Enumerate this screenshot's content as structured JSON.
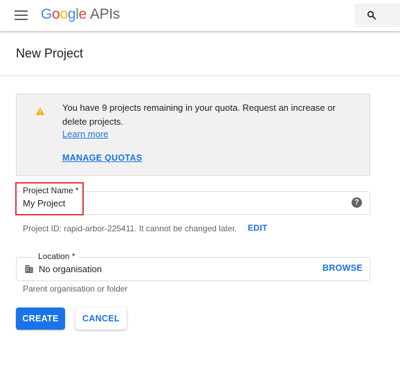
{
  "header": {
    "logo": {
      "letters": [
        {
          "char": "G",
          "color": "#4285F4"
        },
        {
          "char": "o",
          "color": "#EA4335"
        },
        {
          "char": "o",
          "color": "#FBBC05"
        },
        {
          "char": "g",
          "color": "#4285F4"
        },
        {
          "char": "l",
          "color": "#34A853"
        },
        {
          "char": "e",
          "color": "#EA4335"
        }
      ],
      "suffix": "APIs"
    },
    "menu_icon": "hamburger-menu-icon",
    "search_icon": "search-icon"
  },
  "page": {
    "title": "New Project"
  },
  "quota_notice": {
    "icon": "warning-icon",
    "icon_color": "#F9AB00",
    "message": "You have 9 projects remaining in your quota. Request an increase or delete projects.",
    "learn_more": "Learn more",
    "manage_quotas": "MANAGE QUOTAS"
  },
  "project_name": {
    "label": "Project Name *",
    "value": "My Project",
    "help_icon": "help-icon",
    "highlight_color": "#E53935"
  },
  "project_id": {
    "text": "Project ID: rapid-arbor-225411. It cannot be changed later.",
    "edit_label": "EDIT"
  },
  "location": {
    "label": "Location *",
    "icon": "building-icon",
    "value": "No organisation",
    "browse_label": "BROWSE",
    "hint": "Parent organisation or folder"
  },
  "actions": {
    "create_label": "CREATE",
    "cancel_label": "CANCEL",
    "primary_color": "#1A73E8"
  }
}
